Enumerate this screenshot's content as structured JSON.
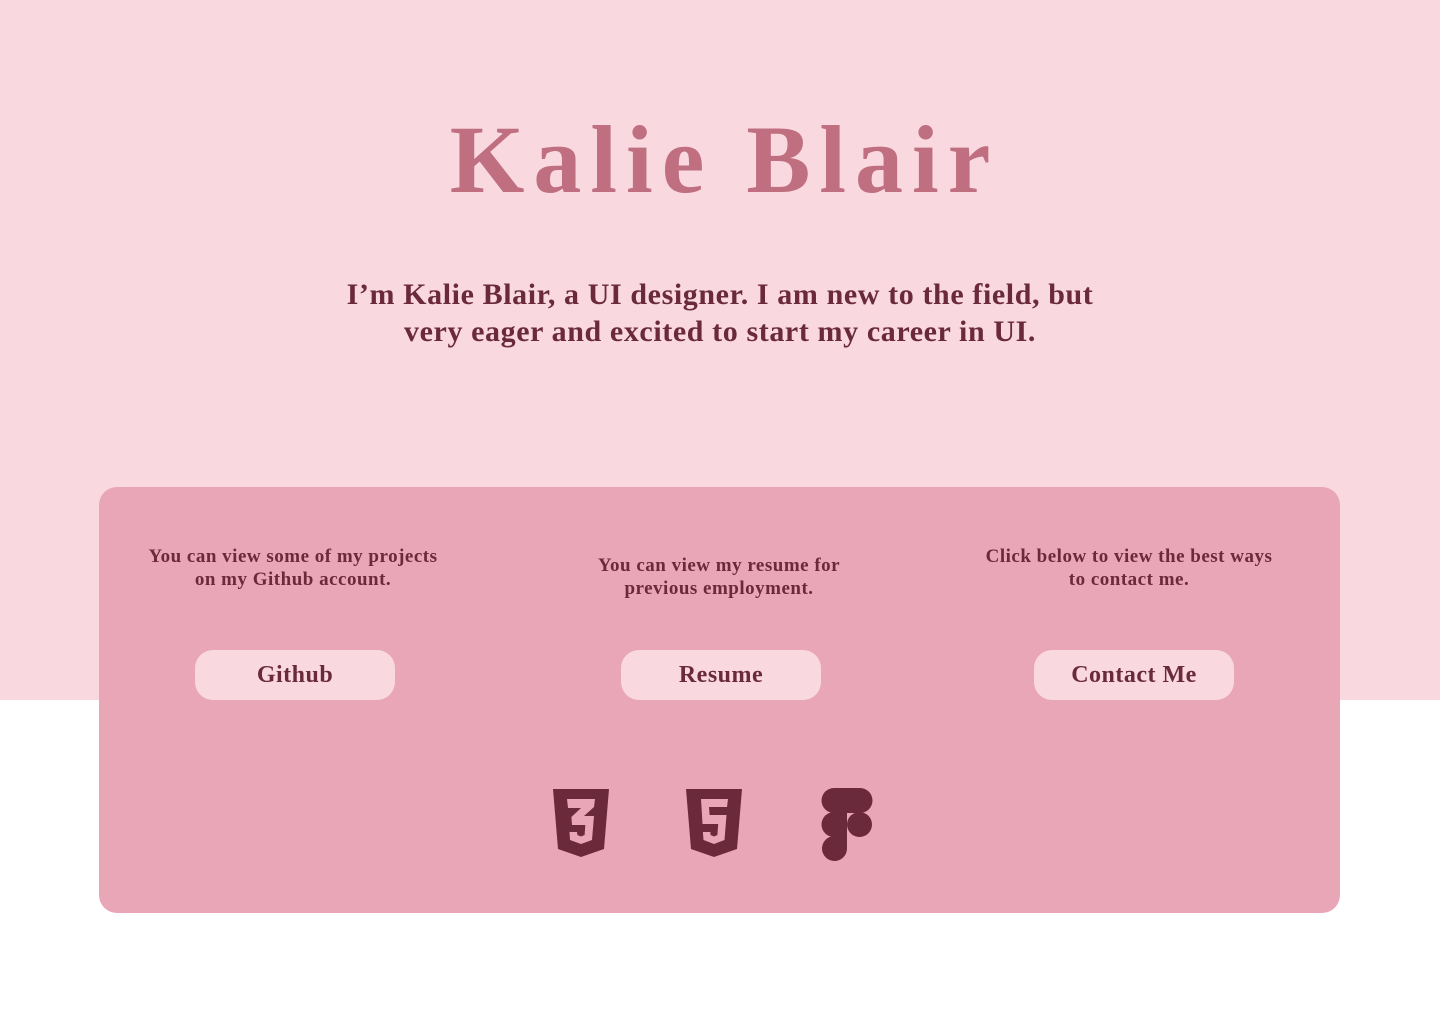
{
  "hero": {
    "name": "Kalie Blair",
    "intro": "I’m Kalie Blair, a UI designer. I am new to the field, but very eager and excited to start my career in UI."
  },
  "links": [
    {
      "description": "You can view some of my projects on my Github account.",
      "button_label": "Github"
    },
    {
      "description": "You can view my resume for previous employment.",
      "button_label": "Resume"
    },
    {
      "description": "Click below to view the best ways to contact me.",
      "button_label": "Contact Me"
    }
  ],
  "skill_icons": [
    "css3-icon",
    "html5-icon",
    "figma-icon"
  ],
  "colors": {
    "hero_background": "#f9d8e0",
    "page_background": "#ffffff",
    "title": "#bf6f80",
    "text": "#6a2a3c",
    "card": "#e8a6b6",
    "button": "#f9d8e0",
    "icon": "#6a2a3c"
  }
}
